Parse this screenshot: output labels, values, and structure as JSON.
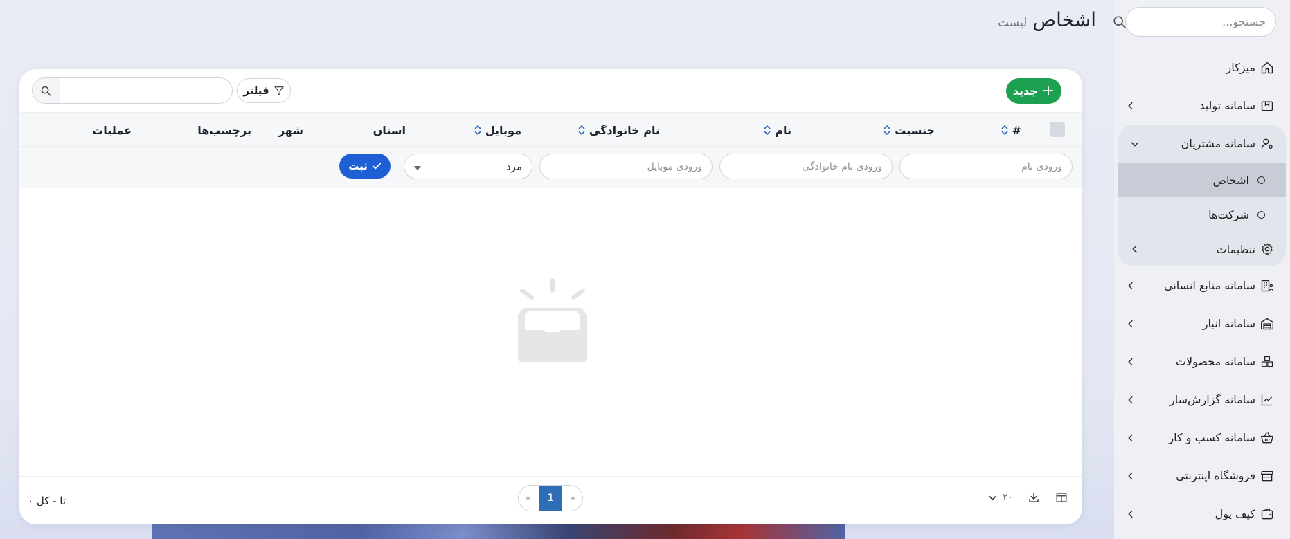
{
  "page": {
    "title": "اشخاص",
    "subtitle": "لیست"
  },
  "sidebar": {
    "search_placeholder": "جستجو...",
    "items": [
      {
        "label": "میزکار",
        "icon": "home-icon"
      },
      {
        "label": "سامانه تولید",
        "icon": "box-icon"
      },
      {
        "label": "سامانه مشتریان",
        "icon": "user-gear-icon",
        "expanded": true,
        "children": [
          {
            "label": "اشخاص",
            "active": true
          },
          {
            "label": "شرکت‌ها",
            "active": false
          }
        ]
      },
      {
        "label": "تنظیمات",
        "icon": "gear-icon"
      },
      {
        "label": "سامانه منابع انسانی",
        "icon": "building-user-icon"
      },
      {
        "label": "سامانه انبار",
        "icon": "warehouse-icon"
      },
      {
        "label": "سامانه محصولات",
        "icon": "boxes-icon"
      },
      {
        "label": "سامانه گزارش‌ساز",
        "icon": "chart-line-icon"
      },
      {
        "label": "سامانه کسب و کار",
        "icon": "basket-icon"
      },
      {
        "label": "فروشگاه اینترنتی",
        "icon": "store-icon"
      },
      {
        "label": "کیف پول",
        "icon": "wallet-icon"
      }
    ]
  },
  "toolbar": {
    "new_label": "جدید",
    "filter_label": "فیلتر",
    "search_value": ""
  },
  "table": {
    "columns": [
      {
        "label": "#",
        "sortable": true
      },
      {
        "label": "جنسیت",
        "sortable": true
      },
      {
        "label": "نام",
        "sortable": true
      },
      {
        "label": "نام خانوادگی",
        "sortable": true
      },
      {
        "label": "موبایل",
        "sortable": true
      },
      {
        "label": "استان",
        "sortable": false
      },
      {
        "label": "شهر",
        "sortable": false
      },
      {
        "label": "برچسب‌ها",
        "sortable": false
      },
      {
        "label": "عملیات",
        "sortable": false
      }
    ],
    "filter_row": {
      "first_name_placeholder": "ورودی نام",
      "last_name_placeholder": "ورودی نام خانوادگی",
      "mobile_placeholder": "ورودی موبایل",
      "gender_value": "مرد",
      "submit_label": "ثبت"
    },
    "rows": []
  },
  "footer": {
    "total_text": "تا - کل ۰",
    "current_page": "1",
    "page_size": "۲۰"
  },
  "colors": {
    "new_button": "#1ea052",
    "submit_button": "#1f5fd6",
    "pager_active": "#2f6db7",
    "sort_icon": "#2f6db7"
  }
}
